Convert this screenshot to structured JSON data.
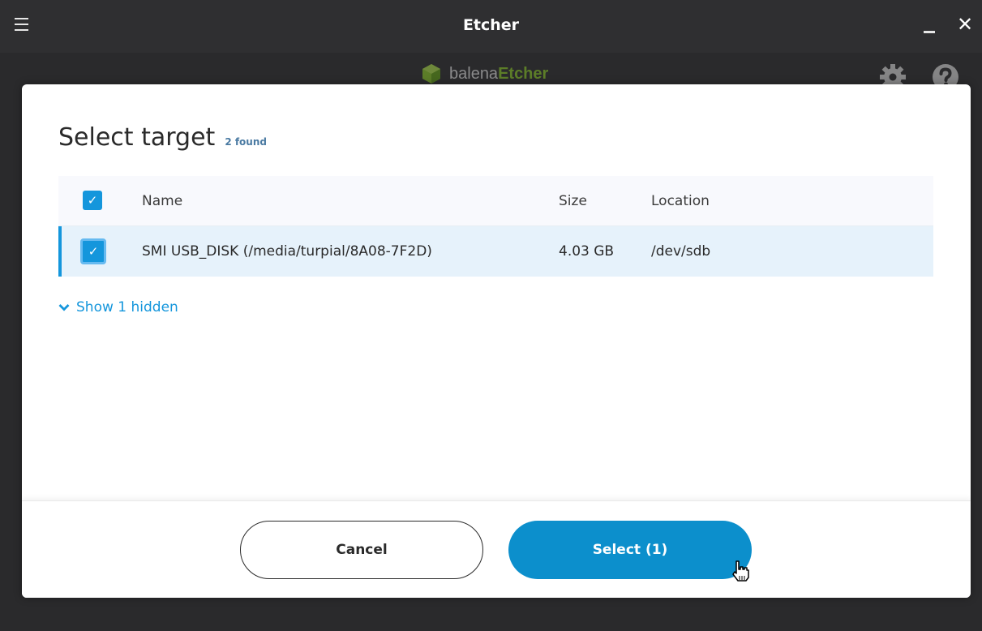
{
  "window": {
    "title": "Etcher"
  },
  "logo": {
    "brand_prefix": "balena",
    "brand_suffix": "Etcher"
  },
  "modal": {
    "title": "Select target",
    "found_count": "2 found",
    "table": {
      "columns": [
        "Name",
        "Size",
        "Location"
      ],
      "rows": [
        {
          "name": "SMI USB_DISK (/media/turpial/8A08-7F2D)",
          "size": "4.03 GB",
          "location": "/dev/sdb",
          "selected": true
        }
      ]
    },
    "show_hidden_label": "Show 1 hidden",
    "cancel_label": "Cancel",
    "select_label": "Select (1)"
  },
  "colors": {
    "accent": "#1496dc",
    "select_button": "#0c8fcc",
    "row_selected_bg": "#e6f2fb",
    "brand_green": "#85c225",
    "titlebar_bg": "#2f2f31"
  }
}
